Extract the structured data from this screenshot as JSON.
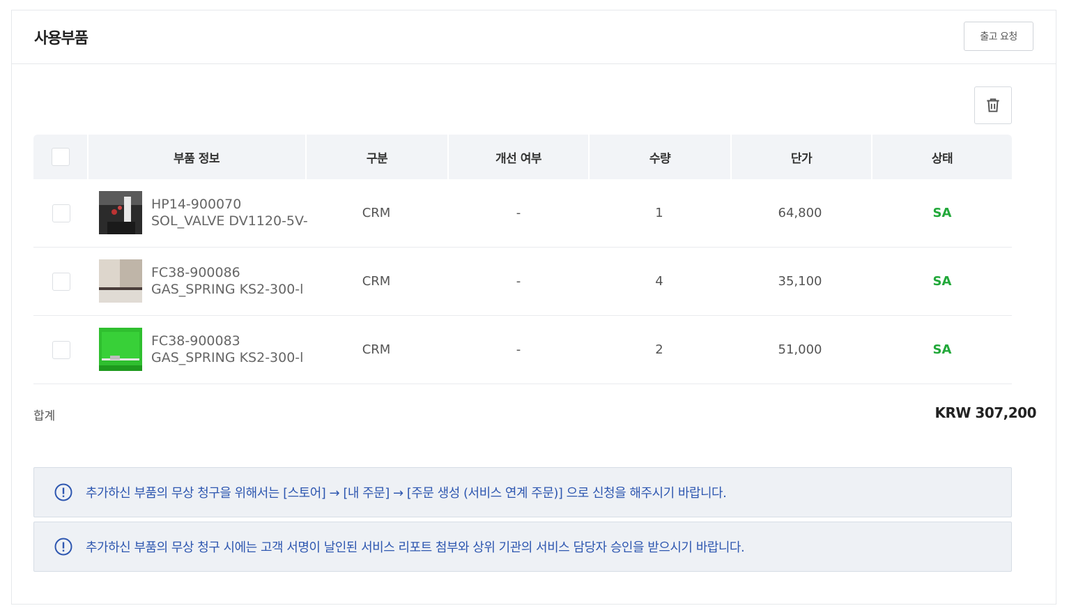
{
  "panel": {
    "title": "사용부품",
    "release_button": "출고 요청"
  },
  "table": {
    "headers": [
      "부품 정보",
      "구분",
      "개선 여부",
      "수량",
      "단가",
      "상태"
    ],
    "rows": [
      {
        "code": "HP14-900070",
        "name": "SOL_VALVE DV1120-5V-",
        "category": "CRM",
        "improved": "-",
        "qty": "1",
        "price": "64,800",
        "status": "SA",
        "thumb": "dark-photo"
      },
      {
        "code": "FC38-900086",
        "name": "GAS_SPRING KS2-300-l",
        "category": "CRM",
        "improved": "-",
        "qty": "4",
        "price": "35,100",
        "status": "SA",
        "thumb": "beige-photo"
      },
      {
        "code": "FC38-900083",
        "name": "GAS_SPRING KS2-300-l",
        "category": "CRM",
        "improved": "-",
        "qty": "2",
        "price": "51,000",
        "status": "SA",
        "thumb": "green-photo"
      }
    ]
  },
  "total": {
    "label": "합계",
    "value": "KRW 307,200"
  },
  "notices": [
    "추가하신 부품의 무상 청구을 위해서는 [스토어] → [내 주문] → [주문 생성 (서비스 연계 주문)] 으로 신청을 해주시기 바랍니다.",
    "추가하신 부품의 무상 청구 시에는 고객 서명이 날인된 서비스 리포트 첨부와 상위 기관의 서비스 담당자 승인을 받으시기 바랍니다."
  ],
  "colors": {
    "status": "#22a83a",
    "notice_text": "#2e57b0",
    "header_bg": "#f2f4f7"
  },
  "icons": [
    "trash-icon",
    "info-circle-icon"
  ]
}
